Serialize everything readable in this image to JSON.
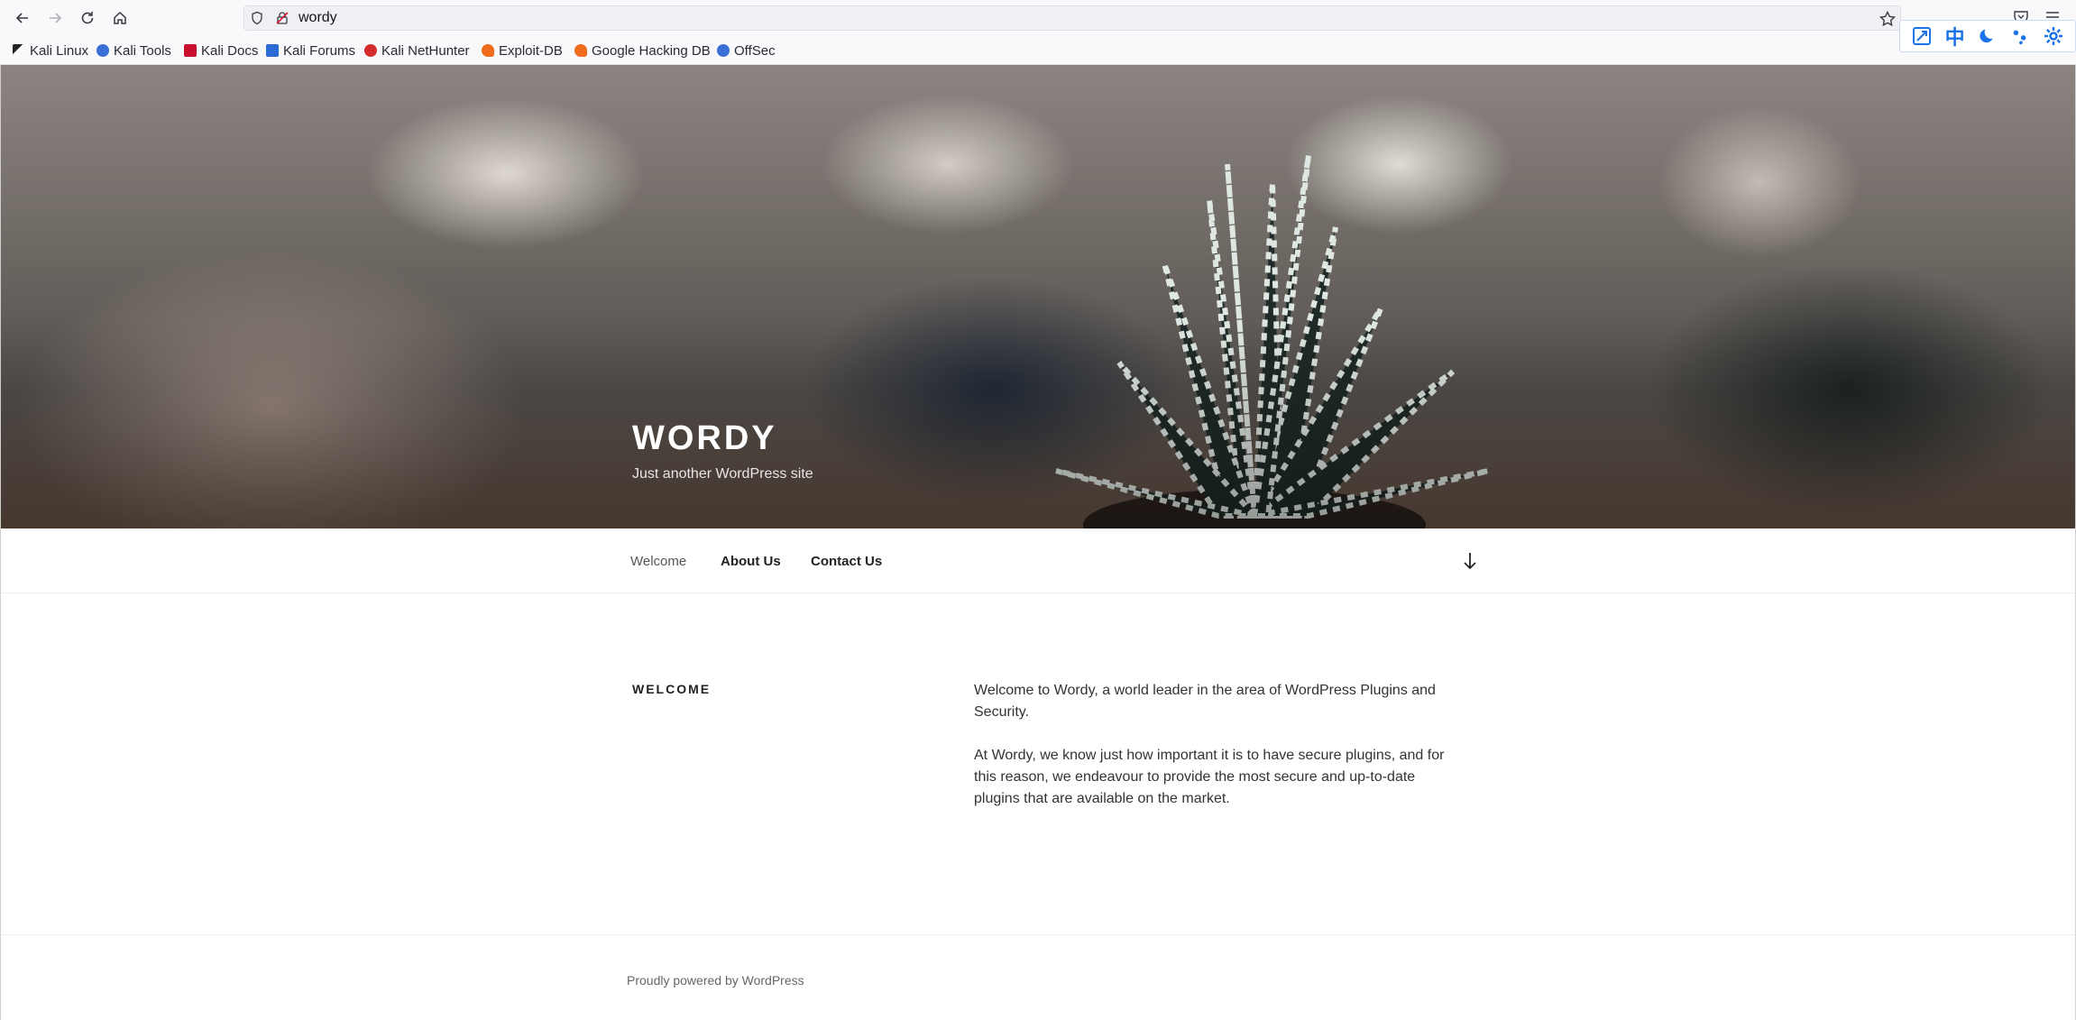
{
  "browser": {
    "url": "wordy",
    "bookmarks": [
      {
        "label": "Kali Linux",
        "icon": "kali-dragon-icon",
        "color": "#222222"
      },
      {
        "label": "Kali Tools",
        "icon": "kali-tools-icon",
        "color": "#3b6fd6"
      },
      {
        "label": "Kali Docs",
        "icon": "kali-docs-icon",
        "color": "#c8102e"
      },
      {
        "label": "Kali Forums",
        "icon": "kali-forums-icon",
        "color": "#2b6bd6"
      },
      {
        "label": "Kali NetHunter",
        "icon": "nethunter-icon",
        "color": "#d42b2b"
      },
      {
        "label": "Exploit-DB",
        "icon": "exploit-db-icon",
        "color": "#f06b1c"
      },
      {
        "label": "Google Hacking DB",
        "icon": "ghdb-icon",
        "color": "#f06b1c"
      },
      {
        "label": "OffSec",
        "icon": "offsec-icon",
        "color": "#3b6fd6"
      }
    ],
    "extension_icons": [
      "translate-icon",
      "chinese-char-icon",
      "moon-icon",
      "dots-icon",
      "gear-icon"
    ],
    "extension_chinese": "中",
    "accent": "#1a73e8"
  },
  "site": {
    "title": "WORDY",
    "tagline": "Just another WordPress site"
  },
  "nav": {
    "items": [
      {
        "label": "Welcome",
        "current": true
      },
      {
        "label": "About Us",
        "current": false
      },
      {
        "label": "Contact Us",
        "current": false
      }
    ]
  },
  "content": {
    "heading": "WELCOME",
    "paragraphs": [
      "Welcome to Wordy, a world leader in the area of WordPress Plugins and Security.",
      "At Wordy, we know just how important it is to have secure plugins, and for this reason, we endeavour to provide the most secure and up-to-date plugins that are available on the market."
    ]
  },
  "footer": {
    "text": "Proudly powered by WordPress"
  }
}
